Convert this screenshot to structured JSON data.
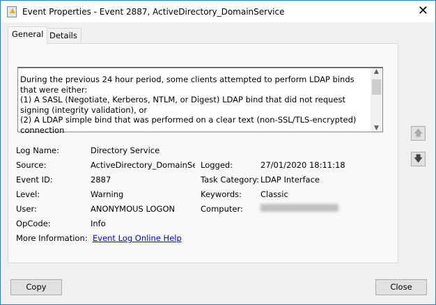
{
  "window": {
    "title": "Event Properties - Event 2887, ActiveDirectory_DomainService",
    "close_glyph": "✕"
  },
  "tabs": [
    {
      "label": "General",
      "active": true
    },
    {
      "label": "Details",
      "active": false
    }
  ],
  "description": [
    "During the previous 24 hour period, some clients attempted to perform LDAP binds that were either:",
    "(1) A SASL (Negotiate, Kerberos, NTLM, or Digest) LDAP bind that did not request signing (integrity validation), or",
    "(2) A LDAP simple bind that was performed on a clear text (non-SSL/TLS-encrypted) connection"
  ],
  "fields": {
    "log_name": {
      "label": "Log Name:",
      "value": "Directory Service"
    },
    "source": {
      "label": "Source:",
      "value": "ActiveDirectory_DomainServ"
    },
    "logged": {
      "label": "Logged:",
      "value": "27/01/2020 18:11:18"
    },
    "event_id": {
      "label": "Event ID:",
      "value": "2887"
    },
    "task_category": {
      "label": "Task Category:",
      "value": "LDAP Interface"
    },
    "level": {
      "label": "Level:",
      "value": "Warning"
    },
    "keywords": {
      "label": "Keywords:",
      "value": "Classic"
    },
    "user": {
      "label": "User:",
      "value": "ANONYMOUS LOGON"
    },
    "computer": {
      "label": "Computer:"
    },
    "opcode": {
      "label": "OpCode:",
      "value": "Info"
    },
    "more_info": {
      "label": "More Information:",
      "link": "Event Log Online Help"
    }
  },
  "buttons": {
    "copy": "Copy",
    "close": "Close"
  }
}
